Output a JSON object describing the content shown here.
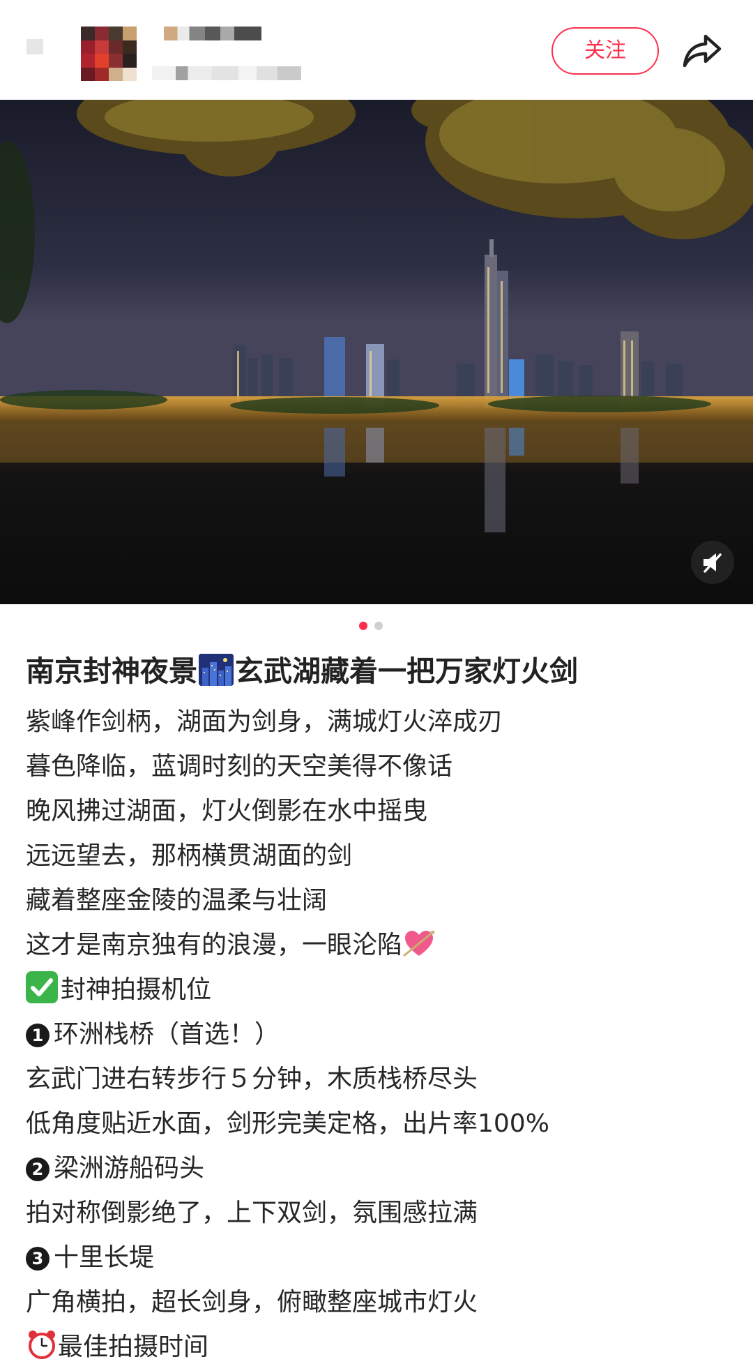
{
  "header": {
    "follow_label": "关注",
    "icons": {
      "share": "share-arrow-icon",
      "mute": "sound-muted-icon"
    }
  },
  "carousel": {
    "total": 2,
    "active_index": 1,
    "colors": {
      "active": "#ff2e4d",
      "inactive": "#d0d0d0"
    }
  },
  "post": {
    "title_part1": "南京封神夜景",
    "title_emoji": "night-city-emoji",
    "title_part2": "玄武湖藏着一把万家灯火剑",
    "lines": [
      "紫峰作剑柄，湖面为剑身，满城灯火淬成刃",
      "暮色降临，蓝调时刻的天空美得不像话",
      "晚风拂过湖面，灯火倒影在水中摇曳",
      "远远望去，那柄横贯湖面的剑",
      "藏着整座金陵的温柔与壮阔",
      "这才是南京独有的浪漫，一眼沦陷"
    ],
    "heart_emoji": "heart-with-arrow-emoji",
    "section_title": "封神拍摄机位",
    "section_emoji": "check-mark-emoji",
    "spots": [
      {
        "num": "1",
        "name": "环洲栈桥（首选！）",
        "desc": [
          "玄武门进右转步行５分钟，木质栈桥尽头",
          "低角度贴近水面，剑形完美定格，出片率100%"
        ]
      },
      {
        "num": "2",
        "name": "梁洲游船码头",
        "desc": [
          "拍对称倒影绝了，上下双剑，氛围感拉满"
        ]
      },
      {
        "num": "3",
        "name": "十里长堤",
        "desc": [
          "广角横拍，超长剑身，俯瞰整座城市灯火"
        ]
      }
    ],
    "time_title": "最佳拍摄时间",
    "time_emoji": "alarm-clock-emoji"
  }
}
